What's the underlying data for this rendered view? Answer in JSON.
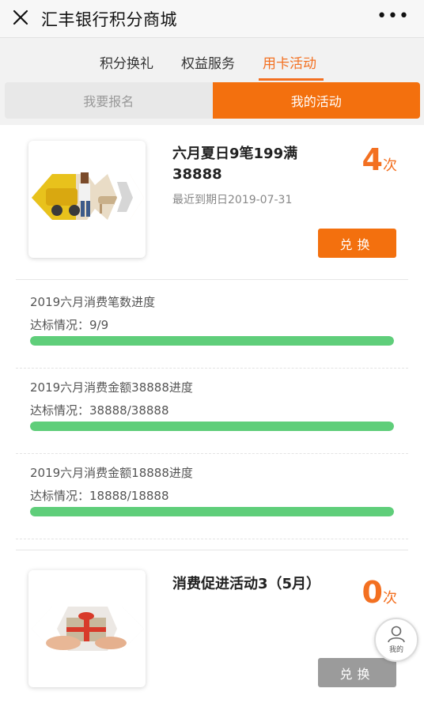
{
  "topbar": {
    "title": "汇丰银行积分商城",
    "more": "•••"
  },
  "tabs": [
    {
      "label": "积分换礼"
    },
    {
      "label": "权益服务"
    },
    {
      "label": "用卡活动",
      "active": true
    }
  ],
  "segment": {
    "left": "我要报名",
    "right": "我的活动",
    "selected": "right"
  },
  "activities": [
    {
      "title": "六月夏日9笔199满38888",
      "date": "最近到期日2019-07-31",
      "count": "4",
      "count_unit": "次",
      "button": "兑换",
      "button_state": "enabled",
      "progress": [
        {
          "label": "2019六月消费笔数进度",
          "status": "达标情况：9/9",
          "fraction": 1.0
        },
        {
          "label": "2019六月消费金额38888进度",
          "status": "达标情况：38888/38888",
          "fraction": 1.0
        },
        {
          "label": "2019六月消费金额18888进度",
          "status": "达标情况：18888/18888",
          "fraction": 1.0
        }
      ]
    },
    {
      "title": "消费促进活动3（5月）",
      "date": "",
      "count": "0",
      "count_unit": "次",
      "button": "兑换",
      "button_state": "disabled"
    }
  ],
  "floating": {
    "label": "我的"
  },
  "colors": {
    "accent": "#f37021",
    "progress": "#5fce7a",
    "disabled": "#9b9b9b"
  }
}
